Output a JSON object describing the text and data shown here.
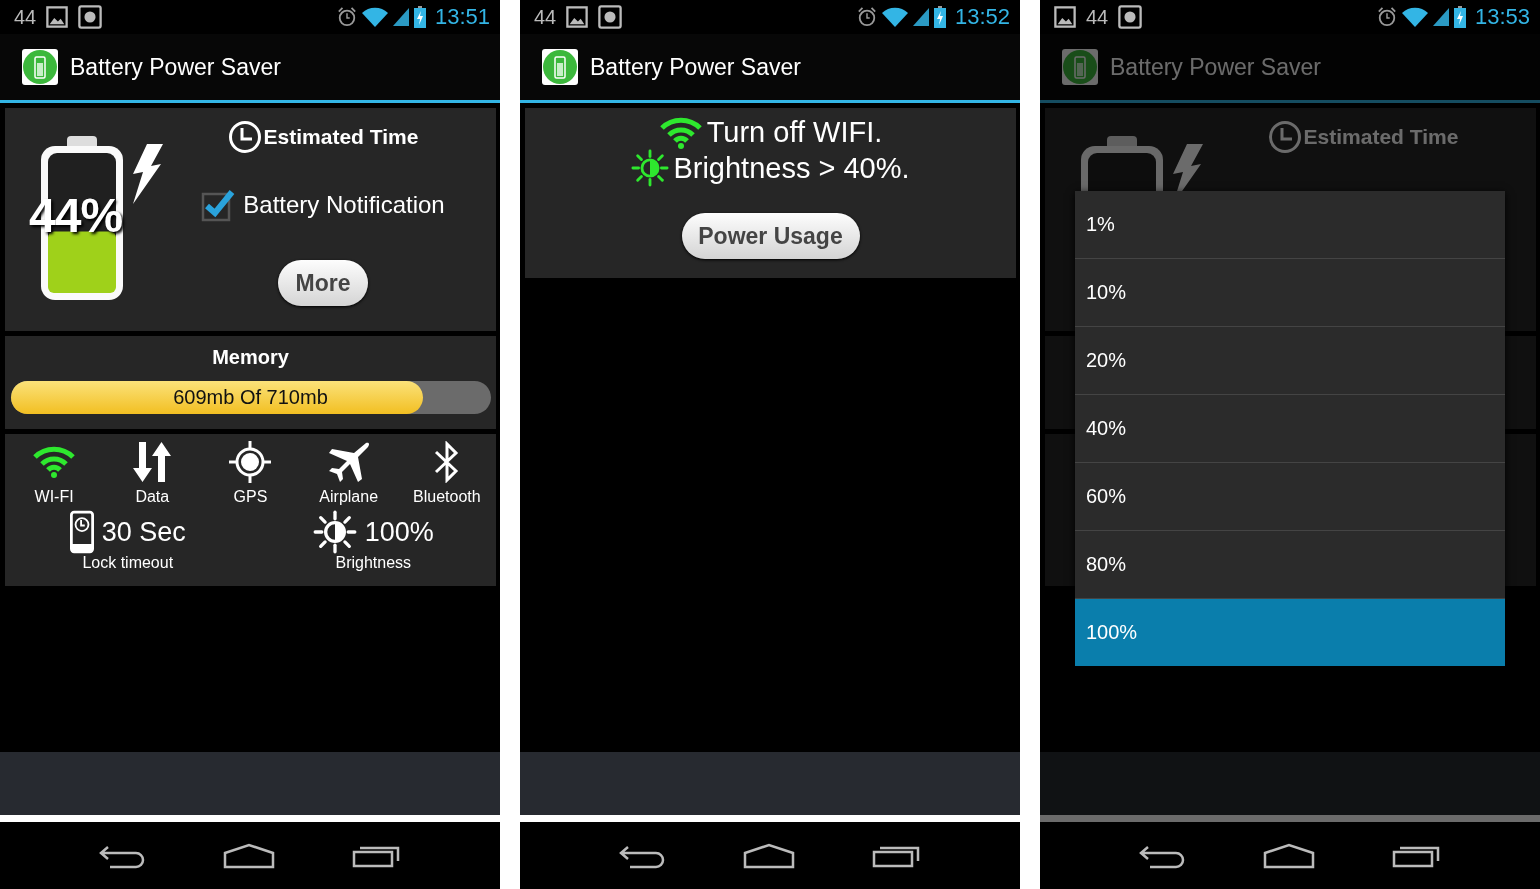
{
  "screens": [
    {
      "kind": "main",
      "status_bar": {
        "notifications": [
          {
            "kind": "count",
            "text": "44"
          },
          {
            "kind": "image"
          },
          {
            "kind": "screenshot"
          }
        ],
        "time": "13:51"
      },
      "app_bar": {
        "title": "Battery Power Saver"
      },
      "battery": {
        "percent": "44%",
        "level": 0.44
      },
      "estimated_time": "Estimated Time",
      "notification": {
        "label": "Battery Notification",
        "checked": true
      },
      "more_button": "More",
      "memory": {
        "title": "Memory",
        "level": 0.86,
        "reading": "609mb Of 710mb"
      },
      "toggles": [
        {
          "kind": "wifi",
          "label": "WI-FI",
          "on": true
        },
        {
          "kind": "data",
          "label": "Data",
          "on": false
        },
        {
          "kind": "gps",
          "label": "GPS",
          "on": false
        },
        {
          "kind": "airplane",
          "label": "Airplane",
          "on": false
        },
        {
          "kind": "bluetooth",
          "label": "Bluetooth",
          "on": false
        }
      ],
      "lock": {
        "value": "30 Sec",
        "label": "Lock timeout"
      },
      "brightness": {
        "value": "100%",
        "label": "Brightness"
      }
    },
    {
      "kind": "tips",
      "status_bar": {
        "notifications": [
          {
            "kind": "count",
            "text": "44"
          },
          {
            "kind": "image"
          },
          {
            "kind": "screenshot"
          }
        ],
        "time": "13:52"
      },
      "app_bar": {
        "title": "Battery Power Saver"
      },
      "tips": [
        {
          "kind": "wifi",
          "text": "Turn off WIFI."
        },
        {
          "kind": "brightness",
          "text": "Brightness > 40%."
        }
      ],
      "button": "Power Usage"
    },
    {
      "kind": "dialog",
      "status_bar": {
        "notifications": [
          {
            "kind": "image"
          },
          {
            "kind": "count",
            "text": "44"
          },
          {
            "kind": "screenshot"
          }
        ],
        "time": "13:53"
      },
      "app_bar": {
        "title": "Battery Power Saver"
      },
      "estimated_time": "Estimated Time",
      "options": [
        {
          "label": "1%",
          "selected": false
        },
        {
          "label": "10%",
          "selected": false
        },
        {
          "label": "20%",
          "selected": false
        },
        {
          "label": "40%",
          "selected": false
        },
        {
          "label": "60%",
          "selected": false
        },
        {
          "label": "80%",
          "selected": false
        },
        {
          "label": "100%",
          "selected": true
        }
      ]
    }
  ]
}
